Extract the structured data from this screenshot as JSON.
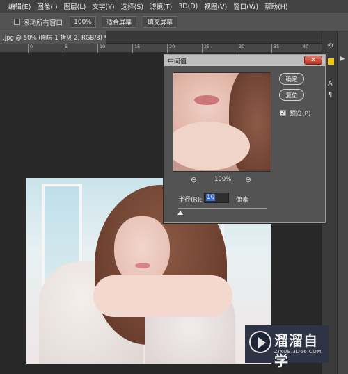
{
  "menu": [
    "编辑(E)",
    "图像(I)",
    "图层(L)",
    "文字(Y)",
    "选择(S)",
    "滤镜(T)",
    "3D(D)",
    "视图(V)",
    "窗口(W)",
    "帮助(H)"
  ],
  "options": {
    "scroll_all_label": "滚动所有窗口",
    "zoom_value": "100%",
    "fit_screen_label": "适合屏幕",
    "fill_screen_label": "填充屏幕"
  },
  "tab": {
    "label": ".jpg @ 50% (图层 1 拷贝 2, RGB/8) *"
  },
  "ruler": [
    "0",
    "5",
    "10",
    "15",
    "20",
    "25",
    "30",
    "35",
    "40"
  ],
  "dialog": {
    "title": "中间值",
    "ok_label": "确定",
    "reset_label": "复位",
    "preview_label": "预览(P)",
    "preview_checked": true,
    "zoom_level": "100%",
    "radius_label": "半径(R):",
    "radius_value": "10",
    "unit_label": "像素",
    "close_label": "✕"
  },
  "watermark": {
    "title": "溜溜自学",
    "url": "ZIXUE.3D66.COM"
  },
  "colors": {
    "accent_yellow": "#f0c810",
    "close_red": "#b83220",
    "selection_blue": "#3a6fd0"
  },
  "icons": {
    "zoom_out": "zoom-out-icon",
    "zoom_in": "zoom-in-icon",
    "play": "play-icon"
  }
}
